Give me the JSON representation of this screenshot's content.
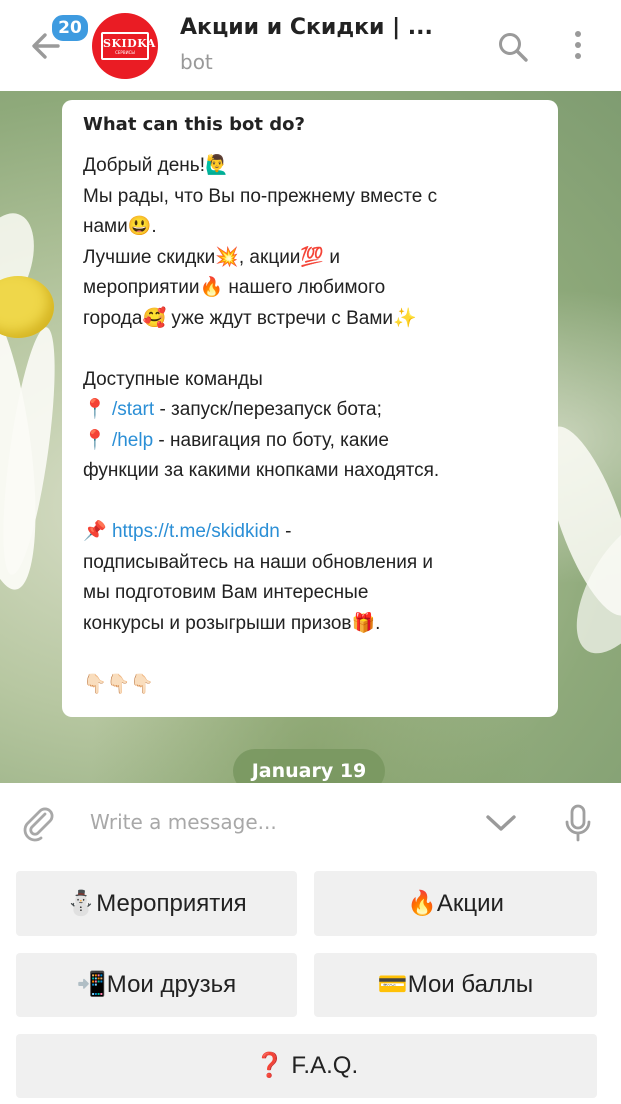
{
  "header": {
    "unread_count": "20",
    "title": "Акции и Скидки | ...",
    "subtitle": "bot",
    "avatar_logo_text": "SKIDKA",
    "avatar_logo_sub": "СЕРВИСЫ",
    "icons": [
      "back-arrow-icon",
      "search-icon",
      "more-vertical-icon"
    ]
  },
  "message": {
    "title": "What can this bot do?",
    "lines": [
      "Добрый день!🙋‍♂️",
      "Мы рады, что Вы по-прежнему вместе с",
      "нами😃.",
      "Лучшие скидки💥, акции💯 и",
      "мероприятии🔥 нашего любимого",
      "города🥰 уже ждут встречи с Вами✨",
      "",
      "Доступные команды"
    ],
    "cmd_start_pin": "📍 ",
    "cmd_start_link": "/start",
    "cmd_start_text": " - запуск/перезапуск бота;",
    "cmd_help_pin": "📍 ",
    "cmd_help_link": "/help",
    "cmd_help_text": " - навигация по боту, какие",
    "cmd_help_text2": "функции за какими кнопками находятся.",
    "channel_pin": "📌 ",
    "channel_link": "https://t.me/skidkidn",
    "channel_dash": " -",
    "channel_lines": [
      "подписывайтесь на наши обновления и",
      "мы подготовим Вам интересные",
      "конкурсы и розыгрыши призов🎁."
    ],
    "pointing": "👇🏻👇🏻👇🏻"
  },
  "date_label": "January 19",
  "input": {
    "placeholder": "Write a message...",
    "icons": [
      "paperclip-icon",
      "chevron-down-icon",
      "microphone-icon"
    ]
  },
  "keyboard": {
    "events": "⛄Мероприятия",
    "promotions": "🔥Акции",
    "friends": "📲Мои друзья",
    "points": "💳Мои баллы",
    "faq": "❓ F.A.Q."
  },
  "colors": {
    "accent_link": "#2b8fd6",
    "badge": "#3e9be0",
    "avatar_bg": "#ea1c24"
  }
}
